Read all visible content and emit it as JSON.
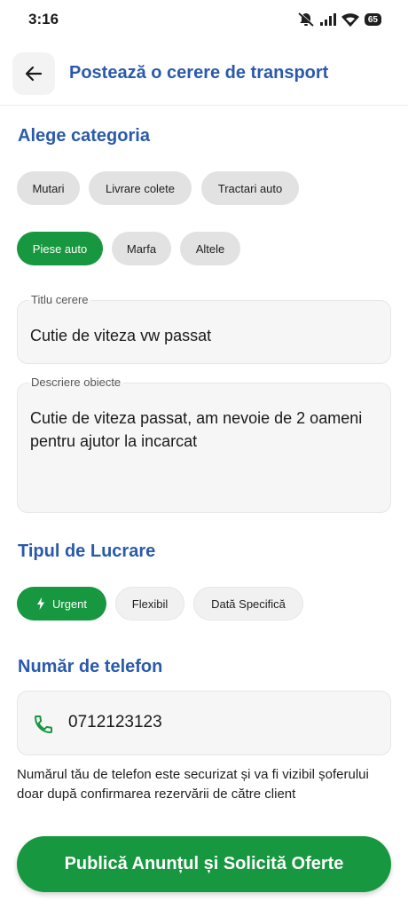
{
  "status_bar": {
    "time": "3:16",
    "battery": "65"
  },
  "header": {
    "title": "Postează o cerere de transport",
    "back_icon": "arrow-left-icon"
  },
  "category": {
    "title": "Alege categoria",
    "chips": [
      "Mutari",
      "Livrare colete",
      "Tractari auto",
      "Piese auto",
      "Marfa",
      "Altele"
    ],
    "selected": "Piese auto"
  },
  "form": {
    "title_label": "Titlu cerere",
    "title_value": "Cutie de viteza vw passat",
    "description_label": "Descriere obiecte",
    "description_value": "Cutie de viteza passat, am nevoie de 2 oameni pentru ajutor la incarcat"
  },
  "work_type": {
    "title": "Tipul de Lucrare",
    "chips": [
      "Urgent",
      "Flexibil",
      "Dată Specifică"
    ],
    "selected": "Urgent"
  },
  "phone": {
    "title": "Număr de telefon",
    "value": "0712123123",
    "helper": "Numărul tău de telefon este securizat și va fi vizibil șoferului doar după confirmarea rezervării de către client"
  },
  "submit_label": "Publică Anunțul și Solicită Oferte",
  "colors": {
    "accent_green": "#17973f",
    "title_blue": "#2a5aab"
  }
}
